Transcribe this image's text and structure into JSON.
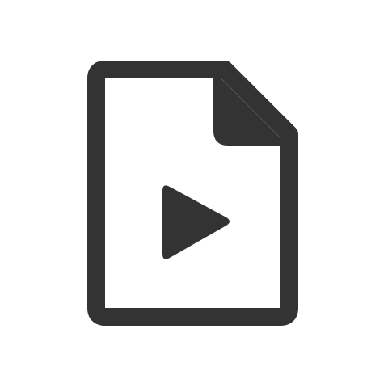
{
  "icon": {
    "name": "video-file-icon",
    "stroke_color": "#333333",
    "fill_color": "#333333",
    "background_color": "#ffffff"
  }
}
